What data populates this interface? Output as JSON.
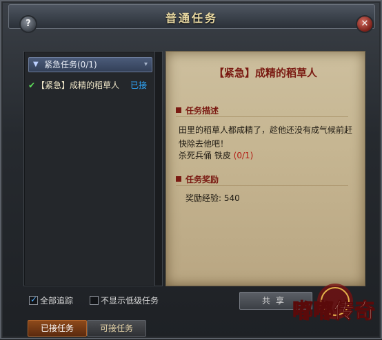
{
  "window": {
    "title": "普通任务"
  },
  "left_panel": {
    "category_label": "紧急任务(0/1)",
    "quests": [
      {
        "name": "【紧急】成精的稻草人",
        "status": "已接"
      }
    ]
  },
  "details": {
    "title": "【紧急】成精的稻草人",
    "desc_header": "任务描述",
    "desc_text": "田里的稻草人都成精了，趁他还没有成气候前赶快除去他吧！",
    "objective_text": "杀死兵俑 铁皮",
    "objective_count": "(0/1)",
    "reward_header": "任务奖励",
    "reward_text": "奖励经验: 540"
  },
  "bottom": {
    "track_all_label": "全部追踪",
    "hide_low_label": "不显示低级任务",
    "share_label": "共享"
  },
  "tabs": {
    "accepted": "已接任务",
    "available": "可接任务"
  },
  "logo": {
    "text": "嘟嘟传奇"
  },
  "icons": [
    "help-icon",
    "close-icon",
    "chevron-down-icon",
    "check-icon"
  ]
}
